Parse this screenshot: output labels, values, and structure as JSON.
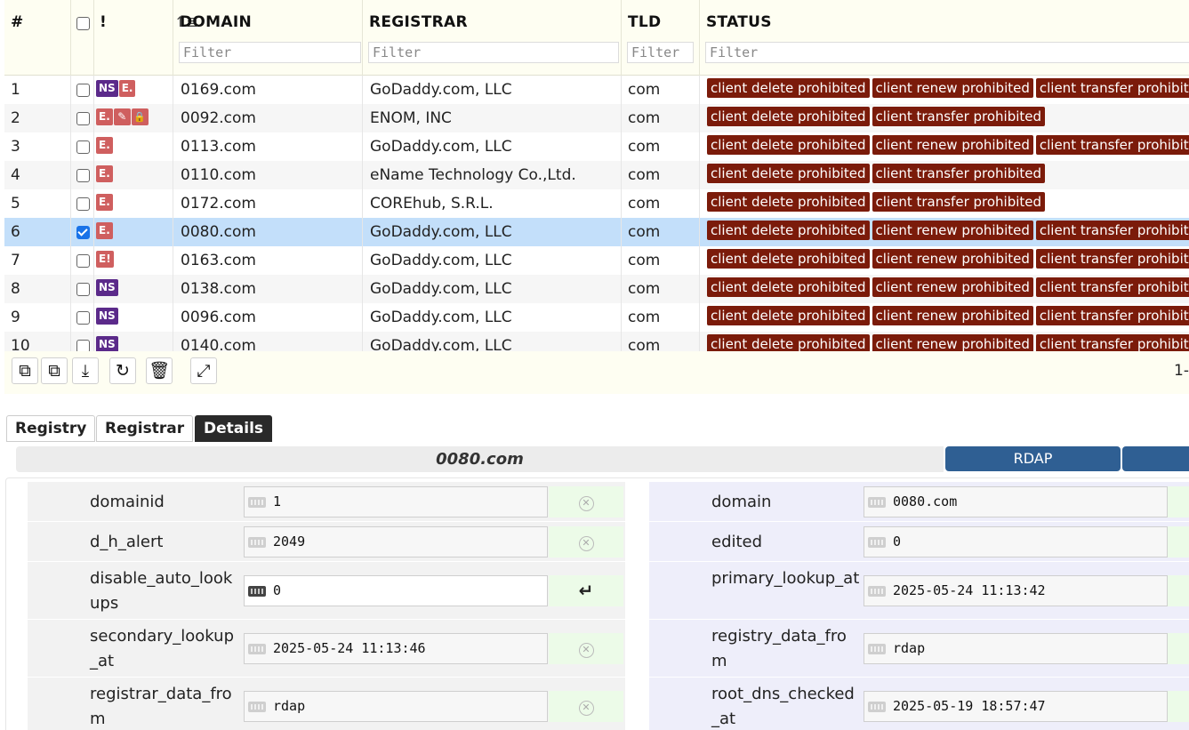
{
  "grid": {
    "columns": {
      "num": "#",
      "flags": "!",
      "domain": "DOMAIN",
      "registrar": "REGISTRAR",
      "tld": "TLD",
      "status": "STATUS"
    },
    "filter_placeholder": "Filter",
    "rows": [
      {
        "num": "1",
        "checked": false,
        "flags": [
          "NS",
          "E."
        ],
        "domain": "0169.com",
        "registrar": "GoDaddy.com, LLC",
        "tld": "com",
        "status": [
          "client delete prohibited",
          "client renew prohibited",
          "client transfer prohibited"
        ]
      },
      {
        "num": "2",
        "checked": false,
        "flags": [
          "E.",
          "pencil-icon",
          "lock-icon"
        ],
        "domain": "0092.com",
        "registrar": "ENOM, INC",
        "tld": "com",
        "status": [
          "client delete prohibited",
          "client transfer prohibited"
        ]
      },
      {
        "num": "3",
        "checked": false,
        "flags": [
          "E."
        ],
        "domain": "0113.com",
        "registrar": "GoDaddy.com, LLC",
        "tld": "com",
        "status": [
          "client delete prohibited",
          "client renew prohibited",
          "client transfer prohibited"
        ]
      },
      {
        "num": "4",
        "checked": false,
        "flags": [
          "E."
        ],
        "domain": "0110.com",
        "registrar": "eName Technology Co.,Ltd.",
        "tld": "com",
        "status": [
          "client delete prohibited",
          "client transfer prohibited"
        ]
      },
      {
        "num": "5",
        "checked": false,
        "flags": [
          "E."
        ],
        "domain": "0172.com",
        "registrar": "COREhub, S.R.L.",
        "tld": "com",
        "status": [
          "client delete prohibited",
          "client transfer prohibited"
        ]
      },
      {
        "num": "6",
        "checked": true,
        "flags": [
          "E."
        ],
        "domain": "0080.com",
        "registrar": "GoDaddy.com, LLC",
        "tld": "com",
        "status": [
          "client delete prohibited",
          "client renew prohibited",
          "client transfer prohibited"
        ]
      },
      {
        "num": "7",
        "checked": false,
        "flags": [
          "E!"
        ],
        "domain": "0163.com",
        "registrar": "GoDaddy.com, LLC",
        "tld": "com",
        "status": [
          "client delete prohibited",
          "client renew prohibited",
          "client transfer prohibited"
        ]
      },
      {
        "num": "8",
        "checked": false,
        "flags": [
          "NS"
        ],
        "domain": "0138.com",
        "registrar": "GoDaddy.com, LLC",
        "tld": "com",
        "status": [
          "client delete prohibited",
          "client renew prohibited",
          "client transfer prohibited"
        ]
      },
      {
        "num": "9",
        "checked": false,
        "flags": [
          "NS"
        ],
        "domain": "0096.com",
        "registrar": "GoDaddy.com, LLC",
        "tld": "com",
        "status": [
          "client delete prohibited",
          "client renew prohibited",
          "client transfer prohibited"
        ]
      },
      {
        "num": "10",
        "checked": false,
        "flags": [
          "NS"
        ],
        "domain": "0140.com",
        "registrar": "GoDaddy.com, LLC",
        "tld": "com",
        "status": [
          "client delete prohibited",
          "client renew prohibited",
          "client transfer prohibited"
        ]
      }
    ],
    "selected_row": 5
  },
  "toolbar": {
    "buttons": [
      "copy-icon",
      "copy-down-icon",
      "download-icon",
      "refresh-icon",
      "trash-icon",
      "expand-icon"
    ],
    "pager_text": "1-"
  },
  "tabs": [
    {
      "label": "Registry",
      "active": false
    },
    {
      "label": "Registrar",
      "active": false
    },
    {
      "label": "Details",
      "active": true
    }
  ],
  "details": {
    "title": "0080.com",
    "rdap_button": "RDAP",
    "left_fields": [
      {
        "label": "domainid",
        "value": "1",
        "editable": false
      },
      {
        "label": "d_h_alert",
        "value": "2049",
        "editable": false
      },
      {
        "label": "disable_auto_lookups",
        "value": "0",
        "editable": true
      },
      {
        "label": "secondary_lookup_at",
        "value": "2025-05-24 11:13:46",
        "editable": false
      },
      {
        "label": "registrar_data_from",
        "value": "rdap",
        "editable": false
      }
    ],
    "right_fields": [
      {
        "label": "domain",
        "value": "0080.com"
      },
      {
        "label": "edited",
        "value": "0"
      },
      {
        "label": "primary_lookup_at",
        "value": "2025-05-24 11:13:42"
      },
      {
        "label": "registry_data_from",
        "value": "rdap"
      },
      {
        "label": "root_dns_checked_at",
        "value": "2025-05-19 18:57:47"
      }
    ]
  },
  "colors": {
    "status_badge": "#7b1b0a",
    "flag_ns": "#5b2a8a",
    "flag_e": "#cf5f5f",
    "selected_row": "#c3dffa",
    "rdap_button": "#2f5f93"
  }
}
